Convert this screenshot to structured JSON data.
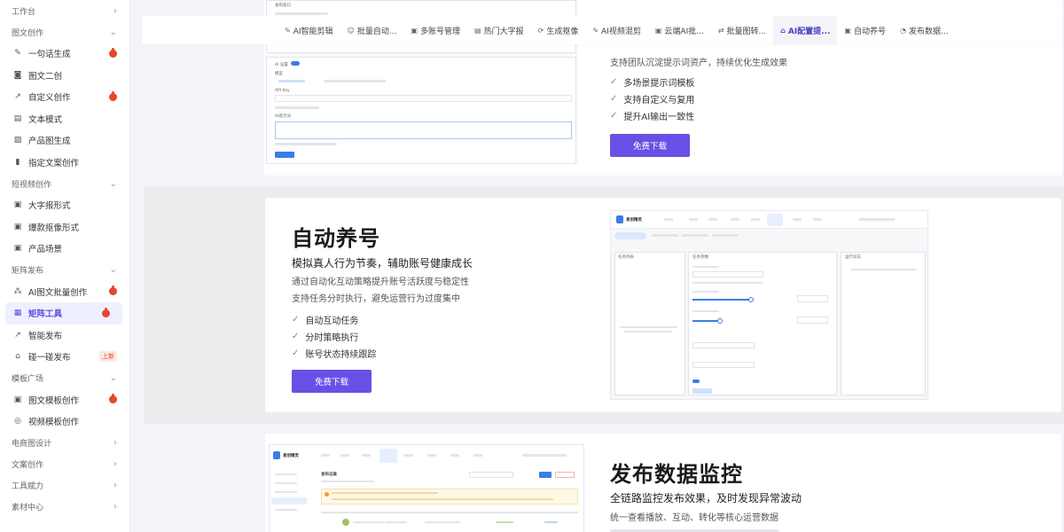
{
  "sidebar": {
    "groups": [
      {
        "label": "工作台",
        "chevron": "›"
      },
      {
        "label": "图文创作",
        "chevron": "⌄",
        "items": [
          {
            "label": "一句话生成",
            "icon": "pen-icon",
            "hot": true
          },
          {
            "label": "图文二创",
            "icon": "camera-icon",
            "hot": false
          },
          {
            "label": "自定义创作",
            "icon": "share-icon",
            "hot": true
          },
          {
            "label": "文本模式",
            "icon": "doc-icon",
            "hot": false
          },
          {
            "label": "产品图生成",
            "icon": "image-icon",
            "hot": false
          },
          {
            "label": "指定文案创作",
            "icon": "file-icon",
            "hot": false
          }
        ]
      },
      {
        "label": "短视频创作",
        "chevron": "⌄",
        "items": [
          {
            "label": "大字报形式",
            "icon": "frame-icon",
            "hot": false
          },
          {
            "label": "爆款抠像形式",
            "icon": "frame-icon",
            "hot": false
          },
          {
            "label": "产品场景",
            "icon": "frame-icon",
            "hot": false
          }
        ]
      },
      {
        "label": "矩阵发布",
        "chevron": "⌄",
        "items": [
          {
            "label": "AI图文批量创作",
            "icon": "network-icon",
            "hot": true
          },
          {
            "label": "矩阵工具",
            "icon": "grid-icon",
            "hot": true,
            "active": true
          },
          {
            "label": "智能发布",
            "icon": "share-icon",
            "hot": false
          },
          {
            "label": "碰一碰发布",
            "icon": "home-icon",
            "hot": false,
            "badge": "上新"
          }
        ]
      },
      {
        "label": "模板广场",
        "chevron": "⌄",
        "items": [
          {
            "label": "图文模板创作",
            "icon": "frame-icon",
            "hot": true
          },
          {
            "label": "视频模板创作",
            "icon": "video-icon",
            "hot": false
          }
        ]
      },
      {
        "label": "电商图设计",
        "chevron": "›"
      },
      {
        "label": "文案创作",
        "chevron": "›"
      },
      {
        "label": "工具赋力",
        "chevron": "›"
      },
      {
        "label": "素材中心",
        "chevron": "›"
      }
    ]
  },
  "tabs": [
    {
      "label": "AI智能剪辑",
      "icon": "✎"
    },
    {
      "label": "批量自动...",
      "icon": "☺"
    },
    {
      "label": "多账号管理",
      "icon": "▣"
    },
    {
      "label": "热门大字报",
      "icon": "▤"
    },
    {
      "label": "生成抠像",
      "icon": "⟳"
    },
    {
      "label": "AI视频混剪",
      "icon": "✎"
    },
    {
      "label": "云端AI批...",
      "icon": "▣"
    },
    {
      "label": "批量图转...",
      "icon": "⇄"
    },
    {
      "label": "AI配置提...",
      "icon": "⌂",
      "active": true
    },
    {
      "label": "自动养号",
      "icon": "▣"
    },
    {
      "label": "发布数据...",
      "icon": "◔"
    }
  ],
  "features": {
    "prompt": {
      "desc": "支持团队沉淀提示词资产，持续优化生成效果",
      "items": [
        "多场景提示词模板",
        "支持自定义与复用",
        "提升AI输出一致性"
      ],
      "button": "免费下载",
      "mock": {
        "header": "发布窗口",
        "toggle_label": "AI 设置",
        "model": "模型",
        "field1": "API Key",
        "field2": "AI提示词",
        "save": "保存设置"
      }
    },
    "nurture": {
      "title": "自动养号",
      "subtitle": "模拟真人行为节奏，辅助账号健康成长",
      "desc1": "通过自动化互动策略提升账号活跃度与稳定性",
      "desc2": "支持任务分时执行，避免运营行为过度集中",
      "items": [
        "自动互动任务",
        "分时策略执行",
        "账号状态持续跟踪"
      ],
      "button": "免费下载",
      "mock": {
        "app": "易创精灵",
        "panel1": "任务列表",
        "panel2": "任务参数",
        "panel3": "运行日志"
      }
    },
    "monitor": {
      "title": "发布数据监控",
      "subtitle": "全链路监控发布效果，及时发现异常波动",
      "desc1": "统一查看播放、互动、转化等核心运营数据",
      "mock": {
        "app": "易创精灵",
        "title": "发布记录"
      }
    }
  },
  "colors": {
    "accent": "#6a4fe6",
    "hot": "#e8452c",
    "check": "#4caf50"
  }
}
